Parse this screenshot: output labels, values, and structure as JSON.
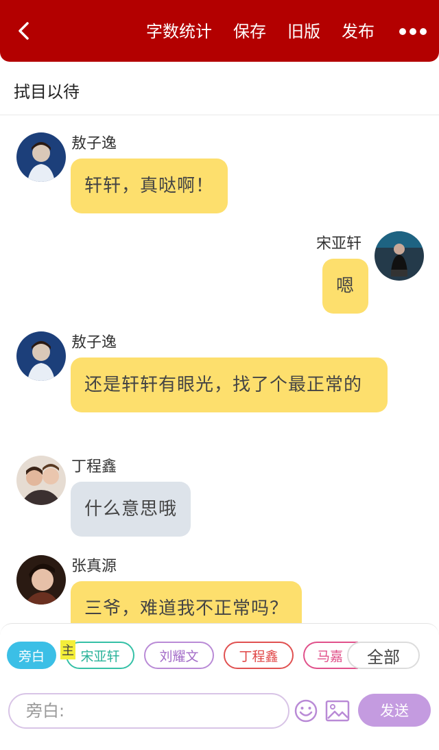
{
  "header": {
    "word_count_label": "字数统计",
    "save_label": "保存",
    "old_version_label": "旧版",
    "publish_label": "发布"
  },
  "story": {
    "title": "拭目以待"
  },
  "messages": [
    {
      "speaker": "敖子逸",
      "text": "轩轩，真哒啊！",
      "side": "left",
      "style": "yellow"
    },
    {
      "speaker": "宋亚轩",
      "text": "嗯",
      "side": "right",
      "style": "yellow"
    },
    {
      "speaker": "敖子逸",
      "text": "还是轩轩有眼光，找了个最正常的",
      "side": "left",
      "style": "yellow"
    },
    {
      "speaker": "丁程鑫",
      "text": "什么意思哦",
      "side": "left",
      "style": "grey"
    },
    {
      "speaker": "张真源",
      "text": "三爷，难道我不正常吗？",
      "side": "left",
      "style": "yellow"
    }
  ],
  "roles": {
    "narration": "旁白",
    "main_tag": "主",
    "items": [
      "宋亚轩",
      "刘耀文",
      "丁程鑫",
      "马嘉"
    ],
    "all_label": "全部"
  },
  "composer": {
    "placeholder": "旁白:",
    "send_label": "发送"
  },
  "colors": {
    "header_bg": "#b30000",
    "bubble_yellow": "#fddf6d",
    "bubble_grey": "#dde3ea",
    "send_bg": "#c49be0",
    "narration_chip": "#3bbfe6"
  }
}
